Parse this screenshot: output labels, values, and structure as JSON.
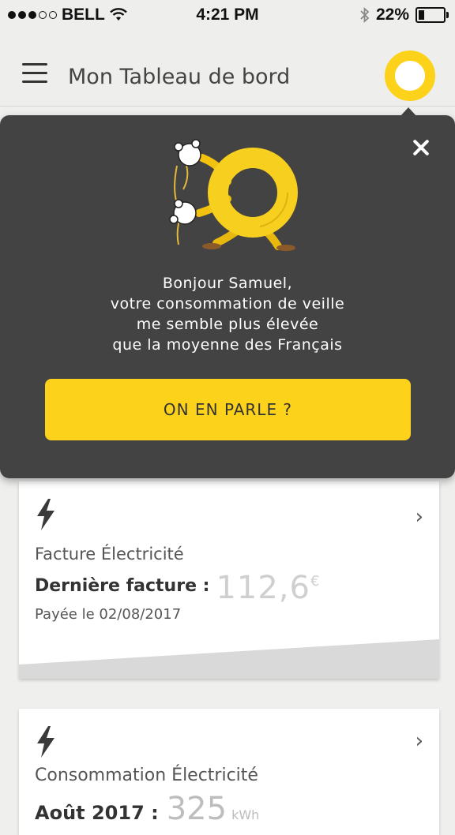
{
  "status_bar": {
    "carrier": "BELL",
    "time": "4:21 PM",
    "battery": "22%",
    "battery_level": 0.22,
    "signal_bars": 3
  },
  "header": {
    "title": "Mon Tableau de bord",
    "menu_icon": "hamburger-icon",
    "avatar_icon": "ring-logo-icon",
    "accent_color": "#fdd21b"
  },
  "popup": {
    "message_lines": [
      "Bonjour Samuel,",
      "votre consommation de veille",
      "me semble plus élevée",
      "que la moyenne des Français"
    ],
    "cta_label": "ON EN PARLE ?",
    "close_icon": "close-icon",
    "mascot": "ring-mascot-illustration",
    "background_color": "#434343"
  },
  "cards": [
    {
      "icon": "lightning-icon",
      "label": "Facture Électricité",
      "last_bill_label": "Dernière facture :",
      "amount": "112,6",
      "currency": "€",
      "paid_text": "Payée le 02/08/2017"
    },
    {
      "icon": "lightning-icon",
      "label": "Consommation Électricité",
      "month_label": "Août 2017 :",
      "value": "325",
      "unit": "kWh"
    }
  ]
}
